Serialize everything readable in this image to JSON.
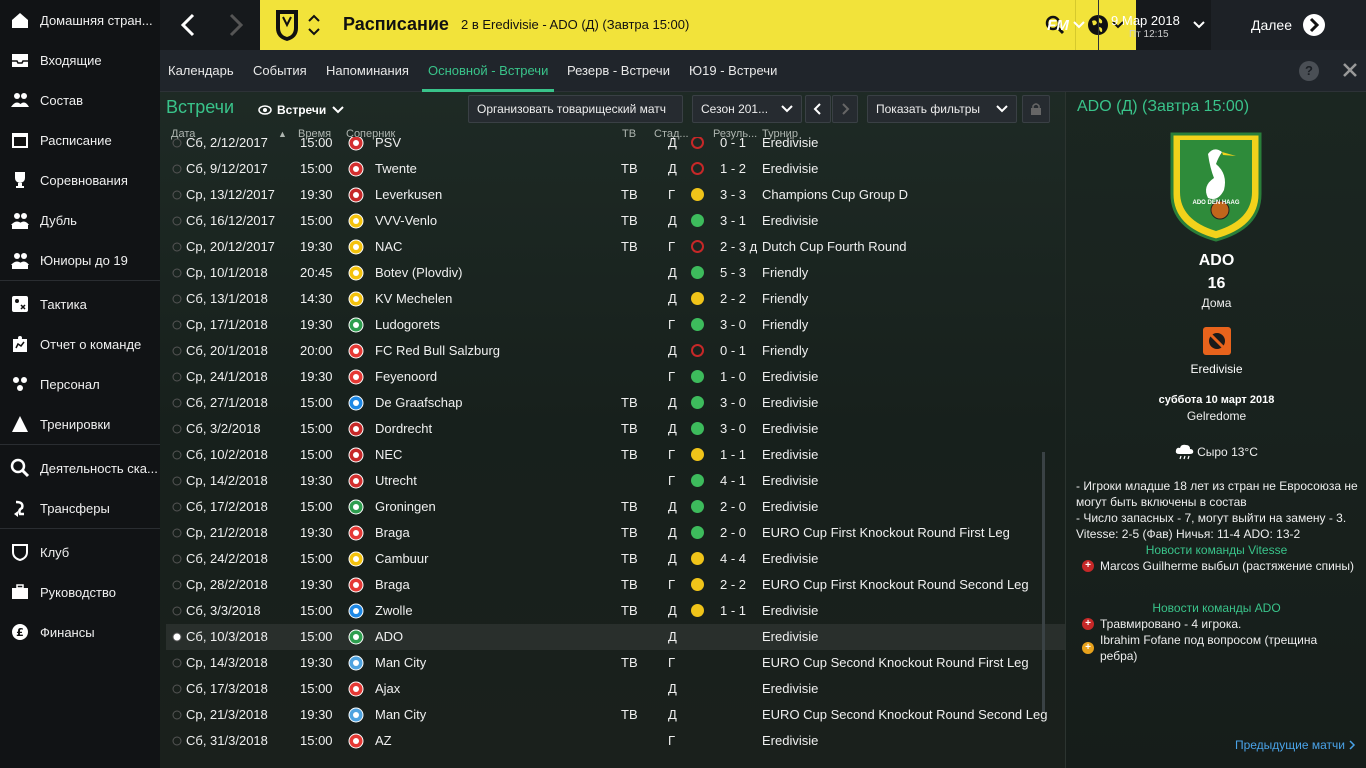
{
  "sidebar": {
    "items": [
      {
        "label": "Домашняя стран...",
        "icon": "home-icon"
      },
      {
        "label": "Входящие",
        "icon": "inbox-icon"
      },
      {
        "label": "Состав",
        "icon": "squad-icon"
      },
      {
        "label": "Расписание",
        "icon": "calendar-icon"
      },
      {
        "label": "Соревнования",
        "icon": "trophy-icon"
      },
      {
        "label": "Дубль",
        "icon": "reserve-team-icon"
      },
      {
        "label": "Юниоры до 19",
        "icon": "u19-team-icon"
      },
      {
        "label": "Тактика",
        "icon": "tactics-icon"
      },
      {
        "label": "Отчет о команде",
        "icon": "report-icon"
      },
      {
        "label": "Персонал",
        "icon": "staff-icon"
      },
      {
        "label": "Тренировки",
        "icon": "training-icon"
      },
      {
        "label": "Деятельность ска...",
        "icon": "scouting-icon"
      },
      {
        "label": "Трансферы",
        "icon": "transfers-icon"
      },
      {
        "label": "Клуб",
        "icon": "club-icon"
      },
      {
        "label": "Руководство",
        "icon": "board-icon"
      },
      {
        "label": "Финансы",
        "icon": "finances-icon"
      }
    ]
  },
  "topbar": {
    "title": "Расписание",
    "subtitle": "2 в Eredivisie - ADO (Д) (Завтра 15:00)",
    "date": "9 Мар 2018",
    "time": "Пт 12:15",
    "fm_label": "FM",
    "continue_label": "Далее"
  },
  "tabs": [
    "Календарь",
    "События",
    "Напоминания",
    "Основной - Встречи",
    "Резерв - Встречи",
    "Ю19 - Встречи"
  ],
  "main": {
    "title": "Встречи",
    "view_dropdown": "Встречи",
    "arrange_friendly": "Организовать товарищеский матч",
    "season": "Сезон 201...",
    "show_filters": "Показать фильтры",
    "columns": {
      "date": "Дата",
      "time": "Время",
      "opponent": "Соперник",
      "tv": "ТВ",
      "venue": "Стад...",
      "result": "Резуль...",
      "competition": "Турнир"
    }
  },
  "matches": [
    {
      "date": "Сб, 2/12/2017",
      "time": "15:00",
      "opponent": "PSV",
      "tv": "",
      "venue": "Д",
      "status": "loss",
      "result": "0 - 1",
      "competition": "Eredivisie",
      "crest": "#d32f2f"
    },
    {
      "date": "Сб, 9/12/2017",
      "time": "15:00",
      "opponent": "Twente",
      "tv": "ТВ",
      "venue": "Д",
      "status": "loss",
      "result": "1 - 2",
      "competition": "Eredivisie",
      "crest": "#d32f2f"
    },
    {
      "date": "Ср, 13/12/2017",
      "time": "19:30",
      "opponent": "Leverkusen",
      "tv": "ТВ",
      "venue": "Г",
      "status": "draw",
      "result": "3 - 3",
      "competition": "Champions Cup Group D",
      "crest": "#c62828"
    },
    {
      "date": "Сб, 16/12/2017",
      "time": "15:00",
      "opponent": "VVV-Venlo",
      "tv": "ТВ",
      "venue": "Д",
      "status": "win",
      "result": "3 - 1",
      "competition": "Eredivisie",
      "crest": "#f4c20d"
    },
    {
      "date": "Ср, 20/12/2017",
      "time": "19:30",
      "opponent": "NAC",
      "tv": "ТВ",
      "venue": "Г",
      "status": "loss",
      "result": "2 - 3 д",
      "competition": "Dutch Cup Fourth Round",
      "crest": "#f4c20d"
    },
    {
      "date": "Ср, 10/1/2018",
      "time": "20:45",
      "opponent": "Botev (Plovdiv)",
      "tv": "",
      "venue": "Д",
      "status": "win",
      "result": "5 - 3",
      "competition": "Friendly",
      "crest": "#f4c20d"
    },
    {
      "date": "Сб, 13/1/2018",
      "time": "14:30",
      "opponent": "KV Mechelen",
      "tv": "",
      "venue": "Д",
      "status": "draw",
      "result": "2 - 2",
      "competition": "Friendly",
      "crest": "#f4c20d"
    },
    {
      "date": "Ср, 17/1/2018",
      "time": "19:30",
      "opponent": "Ludogorets",
      "tv": "",
      "venue": "Г",
      "status": "win",
      "result": "3 - 0",
      "competition": "Friendly",
      "crest": "#2e9e4f"
    },
    {
      "date": "Сб, 20/1/2018",
      "time": "20:00",
      "opponent": "FC Red Bull Salzburg",
      "tv": "",
      "venue": "Д",
      "status": "loss",
      "result": "0 - 1",
      "competition": "Friendly",
      "crest": "#e53935"
    },
    {
      "date": "Ср, 24/1/2018",
      "time": "19:30",
      "opponent": "Feyenoord",
      "tv": "",
      "venue": "Г",
      "status": "win",
      "result": "1 - 0",
      "competition": "Eredivisie",
      "crest": "#e53935"
    },
    {
      "date": "Сб, 27/1/2018",
      "time": "15:00",
      "opponent": "De Graafschap",
      "tv": "ТВ",
      "venue": "Д",
      "status": "win",
      "result": "3 - 0",
      "competition": "Eredivisie",
      "crest": "#1e88e5"
    },
    {
      "date": "Сб, 3/2/2018",
      "time": "15:00",
      "opponent": "Dordrecht",
      "tv": "ТВ",
      "venue": "Д",
      "status": "win",
      "result": "3 - 0",
      "competition": "Eredivisie",
      "crest": "#c62828"
    },
    {
      "date": "Сб, 10/2/2018",
      "time": "15:00",
      "opponent": "NEC",
      "tv": "ТВ",
      "venue": "Г",
      "status": "draw",
      "result": "1 - 1",
      "competition": "Eredivisie",
      "crest": "#c62828"
    },
    {
      "date": "Ср, 14/2/2018",
      "time": "19:30",
      "opponent": "Utrecht",
      "tv": "",
      "venue": "Г",
      "status": "win",
      "result": "4 - 1",
      "competition": "Eredivisie",
      "crest": "#d32f2f"
    },
    {
      "date": "Сб, 17/2/2018",
      "time": "15:00",
      "opponent": "Groningen",
      "tv": "ТВ",
      "venue": "Д",
      "status": "win",
      "result": "2 - 0",
      "competition": "Eredivisie",
      "crest": "#2e9e4f"
    },
    {
      "date": "Ср, 21/2/2018",
      "time": "19:30",
      "opponent": "Braga",
      "tv": "ТВ",
      "venue": "Д",
      "status": "win",
      "result": "2 - 0",
      "competition": "EURO Cup First Knockout Round First Leg",
      "crest": "#e53935"
    },
    {
      "date": "Сб, 24/2/2018",
      "time": "15:00",
      "opponent": "Cambuur",
      "tv": "ТВ",
      "venue": "Д",
      "status": "draw",
      "result": "4 - 4",
      "competition": "Eredivisie",
      "crest": "#f4c20d"
    },
    {
      "date": "Ср, 28/2/2018",
      "time": "19:30",
      "opponent": "Braga",
      "tv": "ТВ",
      "venue": "Г",
      "status": "draw",
      "result": "2 - 2",
      "competition": "EURO Cup First Knockout Round Second Leg",
      "crest": "#e53935"
    },
    {
      "date": "Сб, 3/3/2018",
      "time": "15:00",
      "opponent": "Zwolle",
      "tv": "ТВ",
      "venue": "Д",
      "status": "draw",
      "result": "1 - 1",
      "competition": "Eredivisie",
      "crest": "#1e88e5"
    },
    {
      "date": "Сб, 10/3/2018",
      "time": "15:00",
      "opponent": "ADO",
      "tv": "",
      "venue": "Д",
      "status": "none",
      "result": "",
      "competition": "Eredivisie",
      "crest": "#2e9e4f"
    },
    {
      "date": "Ср, 14/3/2018",
      "time": "19:30",
      "opponent": "Man City",
      "tv": "ТВ",
      "venue": "Г",
      "status": "none",
      "result": "",
      "competition": "EURO Cup Second Knockout Round First Leg",
      "crest": "#4fa3e0"
    },
    {
      "date": "Сб, 17/3/2018",
      "time": "15:00",
      "opponent": "Ajax",
      "tv": "",
      "venue": "Д",
      "status": "none",
      "result": "",
      "competition": "Eredivisie",
      "crest": "#e53935"
    },
    {
      "date": "Ср, 21/3/2018",
      "time": "19:30",
      "opponent": "Man City",
      "tv": "ТВ",
      "venue": "Д",
      "status": "none",
      "result": "",
      "competition": "EURO Cup Second Knockout Round Second Leg",
      "crest": "#4fa3e0"
    },
    {
      "date": "Сб, 31/3/2018",
      "time": "15:00",
      "opponent": "AZ",
      "tv": "",
      "venue": "Г",
      "status": "none",
      "result": "",
      "competition": "Eredivisie",
      "crest": "#e53935"
    }
  ],
  "status_colors": {
    "win": "#3dbb5c",
    "draw": "#f0c419",
    "loss": "#c62828"
  },
  "right_panel": {
    "title": "ADO (Д) (Завтра 15:00)",
    "badge_text": "ADO DEN HAAG",
    "team": "ADO",
    "position": "16",
    "venue": "Дома",
    "competition": "Eredivisie",
    "date": "суббота 10 март 2018",
    "stadium": "Gelredome",
    "weather": "Сыро 13°C",
    "notes": "- Игроки младше 18 лет из стран не Евросоюза не могут быть включены в состав\n- Число запасных - 7, могут выйти на замену - 3.\nVitesse: 2-5 (Фав)  Ничья: 11-4  ADO: 13-2",
    "news_vitesse_title": "Новости команды Vitesse",
    "news_vitesse": [
      "Marcos Guilherme выбыл (растяжение спины)"
    ],
    "news_ado_title": "Новости команды ADO",
    "news_ado": [
      "Травмировано - 4 игрока.",
      "Ibrahim Fofane под вопросом (трещина ребра)"
    ],
    "prev_matches": "Предыдущие матчи"
  },
  "colors": {
    "accent": "#39c38a",
    "topbar_yellow": "#f2e33a",
    "link_blue": "#4aa3e8"
  }
}
